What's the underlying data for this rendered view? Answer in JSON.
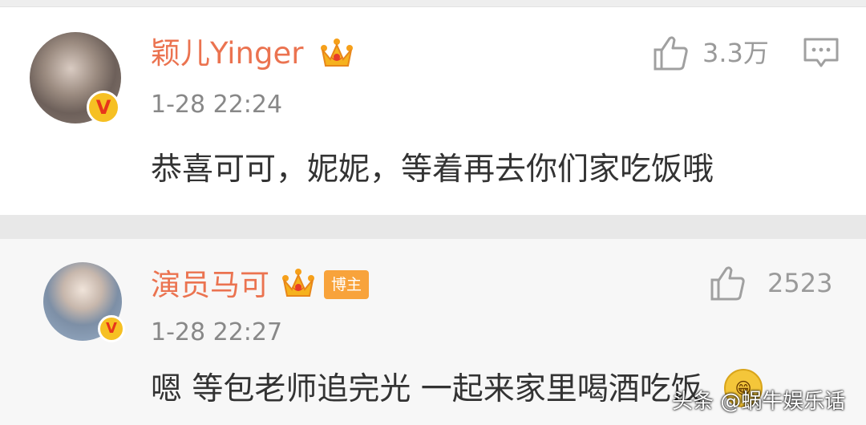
{
  "comments": [
    {
      "username": "颖儿Yinger",
      "time": "1-28 22:24",
      "content": "恭喜可可，妮妮，等着再去你们家吃饭哦",
      "likes": "3.3万",
      "verified_badge": "V",
      "crown_icon": "crown-icon",
      "like_icon": "thumbs-up-icon",
      "reply_icon": "comment-icon"
    },
    {
      "username": "演员马可",
      "tag": "博主",
      "time": "1-28 22:27",
      "content": "嗯 等包老师追完光 一起来家里喝酒吃饭",
      "emoji": "😁",
      "likes": "2523",
      "verified_badge": "V",
      "crown_icon": "crown-icon",
      "like_icon": "thumbs-up-icon"
    }
  ],
  "watermark": "头条 @蜗牛娱乐话",
  "colors": {
    "username": "#eb7350",
    "time": "#888888",
    "content": "#333333",
    "tag_bg": "#f8a33b",
    "verified": "#f6c023"
  }
}
